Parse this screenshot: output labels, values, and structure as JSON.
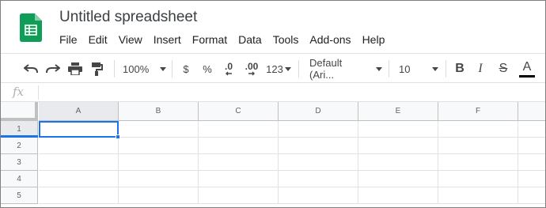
{
  "document": {
    "title": "Untitled spreadsheet"
  },
  "menu": [
    "File",
    "Edit",
    "View",
    "Insert",
    "Format",
    "Data",
    "Tools",
    "Add-ons",
    "Help"
  ],
  "toolbar": {
    "zoom": "100%",
    "currency": "$",
    "percent": "%",
    "decrease_decimal": ".0",
    "increase_decimal": ".00",
    "more_formats": "123",
    "font": "Default (Ari...",
    "font_size": "10",
    "bold": "B",
    "italic": "I",
    "strike": "S",
    "text_color_label": "A"
  },
  "formula_bar": {
    "fx_label": "fx"
  },
  "grid": {
    "columns": [
      "A",
      "B",
      "C",
      "D",
      "E",
      "F"
    ],
    "rows": [
      "1",
      "2",
      "3",
      "4",
      "5"
    ],
    "selected_cell": "A1"
  },
  "colors": {
    "accent": "#1a73e8",
    "logo_green": "#0f9d58",
    "header_bg": "#f8f9fa",
    "text_color_underline": "#000000"
  }
}
